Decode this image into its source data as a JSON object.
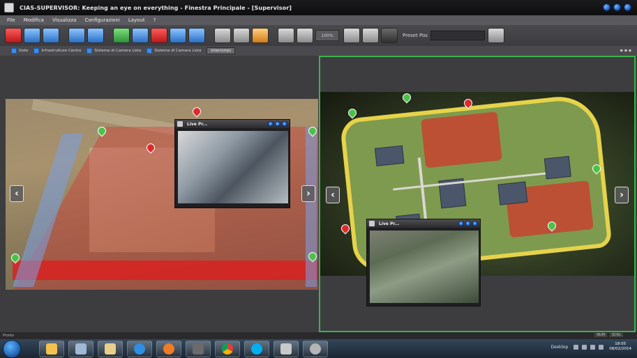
{
  "window": {
    "title": "CIAS-SUPERVISOR: Keeping an eye on everything - Finestra Principale - [Supervisor]"
  },
  "menu": {
    "items": [
      "File",
      "Modifica",
      "Visualizza",
      "Configurazioni",
      "Layout",
      "?"
    ]
  },
  "toolbar": {
    "zoom_value": "100%",
    "preset_label": "Preset Pos"
  },
  "filters": {
    "items": [
      "Siste",
      "Infrastrutture Centro",
      "Sistema di Camera Lista",
      "Sistema di Camera Lista"
    ],
    "button": "Interrompi"
  },
  "left_panel": {
    "popup_title": "Live Pr..."
  },
  "right_panel": {
    "popup_title": "Live Pr..."
  },
  "statusbar": {
    "text": "Pronto",
    "caps": "NUM",
    "scroll": "SCRL"
  },
  "taskbar": {
    "desktop_label": "Desktop",
    "clock_time": "18:05",
    "clock_date": "08/02/2014"
  },
  "colors": {
    "accent_green": "#3cb34a",
    "zone_red": "#e02a2a",
    "title_bg": "#0d0d0f"
  }
}
